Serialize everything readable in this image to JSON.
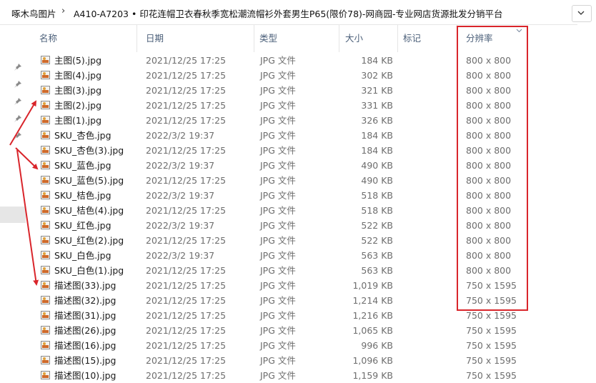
{
  "address_bar": {
    "crumbs": [
      "啄木鸟图片",
      "A410-A7203 • 印花连帽卫衣春秋季宽松潮流帽衫外套男生P65(限价78)-网商园-专业网店货源批发分销平台"
    ]
  },
  "columns": {
    "name": "名称",
    "date": "日期",
    "type": "类型",
    "size": "大小",
    "tags": "标记",
    "resolution": "分辨率"
  },
  "files": [
    {
      "name": "主图(5).jpg",
      "date": "2021/12/25 17:25",
      "type": "JPG 文件",
      "size": "184 KB",
      "resolution": "800 x 800"
    },
    {
      "name": "主图(4).jpg",
      "date": "2021/12/25 17:25",
      "type": "JPG 文件",
      "size": "302 KB",
      "resolution": "800 x 800"
    },
    {
      "name": "主图(3).jpg",
      "date": "2021/12/25 17:25",
      "type": "JPG 文件",
      "size": "321 KB",
      "resolution": "800 x 800"
    },
    {
      "name": "主图(2).jpg",
      "date": "2021/12/25 17:25",
      "type": "JPG 文件",
      "size": "331 KB",
      "resolution": "800 x 800"
    },
    {
      "name": "主图(1).jpg",
      "date": "2021/12/25 17:25",
      "type": "JPG 文件",
      "size": "326 KB",
      "resolution": "800 x 800"
    },
    {
      "name": "SKU_杏色.jpg",
      "date": "2022/3/2 19:37",
      "type": "JPG 文件",
      "size": "184 KB",
      "resolution": "800 x 800"
    },
    {
      "name": "SKU_杏色(3).jpg",
      "date": "2021/12/25 17:25",
      "type": "JPG 文件",
      "size": "184 KB",
      "resolution": "800 x 800"
    },
    {
      "name": "SKU_蓝色.jpg",
      "date": "2022/3/2 19:37",
      "type": "JPG 文件",
      "size": "490 KB",
      "resolution": "800 x 800"
    },
    {
      "name": "SKU_蓝色(5).jpg",
      "date": "2021/12/25 17:25",
      "type": "JPG 文件",
      "size": "490 KB",
      "resolution": "800 x 800"
    },
    {
      "name": "SKU_桔色.jpg",
      "date": "2022/3/2 19:37",
      "type": "JPG 文件",
      "size": "518 KB",
      "resolution": "800 x 800"
    },
    {
      "name": "SKU_桔色(4).jpg",
      "date": "2021/12/25 17:25",
      "type": "JPG 文件",
      "size": "518 KB",
      "resolution": "800 x 800"
    },
    {
      "name": "SKU_红色.jpg",
      "date": "2022/3/2 19:37",
      "type": "JPG 文件",
      "size": "522 KB",
      "resolution": "800 x 800"
    },
    {
      "name": "SKU_红色(2).jpg",
      "date": "2021/12/25 17:25",
      "type": "JPG 文件",
      "size": "522 KB",
      "resolution": "800 x 800"
    },
    {
      "name": "SKU_白色.jpg",
      "date": "2022/3/2 19:37",
      "type": "JPG 文件",
      "size": "563 KB",
      "resolution": "800 x 800"
    },
    {
      "name": "SKU_白色(1).jpg",
      "date": "2021/12/25 17:25",
      "type": "JPG 文件",
      "size": "563 KB",
      "resolution": "800 x 800"
    },
    {
      "name": "描述图(33).jpg",
      "date": "2021/12/25 17:25",
      "type": "JPG 文件",
      "size": "1,019 KB",
      "resolution": "750 x 1595"
    },
    {
      "name": "描述图(32).jpg",
      "date": "2021/12/25 17:25",
      "type": "JPG 文件",
      "size": "1,214 KB",
      "resolution": "750 x 1595"
    },
    {
      "name": "描述图(31).jpg",
      "date": "2021/12/25 17:25",
      "type": "JPG 文件",
      "size": "1,216 KB",
      "resolution": "750 x 1595"
    },
    {
      "name": "描述图(26).jpg",
      "date": "2021/12/25 17:25",
      "type": "JPG 文件",
      "size": "1,065 KB",
      "resolution": "750 x 1595"
    },
    {
      "name": "描述图(16).jpg",
      "date": "2021/12/25 17:25",
      "type": "JPG 文件",
      "size": "996 KB",
      "resolution": "750 x 1595"
    },
    {
      "name": "描述图(15).jpg",
      "date": "2021/12/25 17:25",
      "type": "JPG 文件",
      "size": "1,096 KB",
      "resolution": "750 x 1595"
    },
    {
      "name": "描述图(10).jpg",
      "date": "2021/12/25 17:25",
      "type": "JPG 文件",
      "size": "1,159 KB",
      "resolution": "750 x 1595"
    }
  ],
  "colors": {
    "annotation_red": "#d9252b",
    "header_text": "#4c607a",
    "secondary_text": "#6d6d6d"
  },
  "icons": {
    "file": "jpg-image-icon",
    "pin": "pin-icon",
    "sort": "sort-descending-icon",
    "address_dropdown": "chevron-down-icon"
  }
}
